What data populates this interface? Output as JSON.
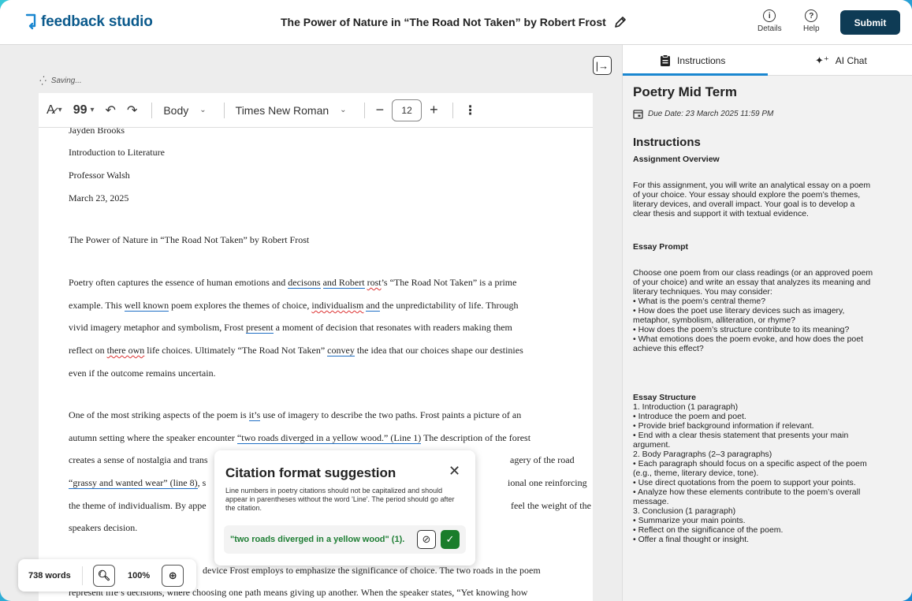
{
  "header": {
    "logo_text": "feedback studio",
    "doc_title": "The Power of Nature in “The Road Not Taken” by Robert Frost",
    "details_label": "Details",
    "help_label": "Help",
    "submit_label": "Submit"
  },
  "editor": {
    "saving_text": "Saving...",
    "toolbar": {
      "style_value": "Body",
      "font_value": "Times New Roman",
      "size_value": "12"
    },
    "doc_lines": [
      "Jayden Brooks",
      "Introduction to Literature",
      "Professor Walsh",
      "March 23, 2025",
      "The Power of Nature in “The Road Not Taken” by Robert Frost"
    ],
    "p1": {
      "l1a": "Poetry often captures the essence of human emotions and ",
      "l1b": "decisons",
      "l1c": " ",
      "l1d": "and Robert",
      "l1e": " ",
      "l1f": "rost",
      "l1g": "’s “The Road Not Taken” is a prime",
      "l2a": "example. This ",
      "l2b": "well known",
      "l2c": " poem explores the themes of choice, ",
      "l2d": "individualism",
      "l2e": " ",
      "l2f": "and",
      "l2g": " the unpredictability of life. Through",
      "l3a": "vivid imagery metaphor and symbolism, Frost ",
      "l3b": "present",
      "l3c": " a moment of decision that resonates with readers making them",
      "l4a": "reflect on ",
      "l4b": "there own",
      "l4c": " life choices. Ultimately “The Road Not Taken” ",
      "l4d": "convey",
      "l4e": " the idea that our choices shape our destinies",
      "l5": "even if the outcome remains uncertain."
    },
    "p2": {
      "l1a": "One of the most striking aspects of the poem is ",
      "l1b": "it’s",
      "l1c": " use of imagery to describe the two paths. Frost paints a picture of an",
      "l2a": "autumn setting where the speaker encounter ",
      "l2b": "“two roads diverged in a yellow wood.” (Line 1)",
      "l2c": " The description of the forest",
      "l3a": "creates a sense of nostalgia and trans",
      "l3b": "agery of the road",
      "l4a": "“grassy and wanted wear” (line 8)",
      "l4b": ", s",
      "l4c": "ional one reinforcing",
      "l5a": "the theme of individualism. By appe",
      "l5b": "feel the weight of the",
      "l6": "speakers decision."
    },
    "p3": {
      "l1": "device Frost employs to emphasize the significance of choice. The two roads in the poem",
      "l2": "represent life’s decisions, where choosing one path means giving up another. When the speaker states, “Yet knowing how"
    },
    "popup": {
      "title": "Citation format suggestion",
      "description": "Line numbers in poetry citations should not be capitalized and should appear in parentheses without the word 'Line'. The period should go after the citation.",
      "suggestion": "\"two roads diverged in a yellow wood\" (1)."
    },
    "wordbar": {
      "word_count": "738 words",
      "zoom": "100%"
    }
  },
  "sidebar": {
    "tab_instructions": "Instructions",
    "tab_ai_chat": "AI Chat",
    "assignment_title": "Poetry Mid Term",
    "due_date": "Due Date: 23 March 2025 11:59 PM",
    "instructions_heading": "Instructions",
    "overview_heading": "Assignment Overview",
    "overview_lines": [
      "For this assignment, you will write an analytical essay on a poem",
      "of your choice. Your essay should explore the poem’s themes,",
      "literary devices, and overall impact. Your goal is to develop a",
      "clear thesis and support it with textual evidence."
    ],
    "prompt_heading": "Essay Prompt",
    "prompt_lines": [
      "Choose one poem from our class readings (or an approved poem",
      "of your choice) and write an essay that analyzes its meaning and",
      "literary techniques. You may consider:",
      " • What is the poem’s central theme?",
      " • How does the poet use literary devices such as imagery,",
      "metaphor, symbolism, alliteration, or rhyme?",
      " • How does the poem’s structure contribute to its meaning?",
      " • What emotions does the poem evoke, and how does the poet",
      "achieve this effect?"
    ],
    "structure_heading": "Essay Structure",
    "structure_lines": [
      " 1. Introduction (1 paragraph)",
      " • Introduce the poem and poet.",
      " • Provide brief background information if relevant.",
      " • End with a clear thesis statement that presents your main",
      "argument.",
      " 2. Body Paragraphs (2–3 paragraphs)",
      " • Each paragraph should focus on a specific aspect of the poem",
      "(e.g., theme, literary device, tone).",
      " • Use direct quotations from the poem to support your points.",
      " • Analyze how these elements contribute to the poem’s overall",
      "message.",
      " 3. Conclusion (1 paragraph)",
      " • Summarize your main points.",
      " • Reflect on the significance of the poem.",
      " • Offer a final thought or insight."
    ]
  },
  "colors": {
    "brand": "#0b5a8c",
    "submit_bg": "#0e3b55",
    "accent": "#1a87d0",
    "success": "#1a7d2b"
  }
}
